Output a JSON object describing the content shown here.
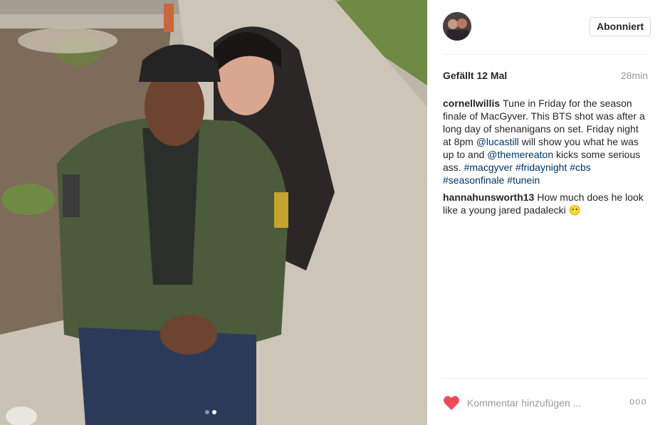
{
  "post": {
    "image_alt": "",
    "carousel": {
      "count": 2,
      "active": 2
    }
  },
  "header": {
    "username": "",
    "follow_label": "Abonniert"
  },
  "stats": {
    "likes": "Gefällt 12 Mal",
    "time": "28min"
  },
  "caption": {
    "user": "cornellwillis",
    "parts": [
      "Tune in Friday for the season finale of MacGyver. This BTS shot was after a long day of shenanigans on set. Friday night at 8pm ",
      "@lucastill",
      " will show you what he was up to and ",
      "@themereaton",
      " kicks some serious ass. ",
      "#macgyver",
      " ",
      "#fridaynight",
      " ",
      "#cbs",
      " ",
      "#seasonfinale",
      " ",
      "#tunein"
    ]
  },
  "comments": [
    {
      "user": "hannahunsworth13",
      "text": "How much does he look like a young jared padalecki 😶"
    }
  ],
  "actions": {
    "like_icon": "heart-icon",
    "comment_placeholder": "Kommentar hinzufügen ...",
    "more_label": "ooo"
  },
  "colors": {
    "heart": "#ed4956",
    "link": "#003569",
    "muted": "#999999"
  }
}
